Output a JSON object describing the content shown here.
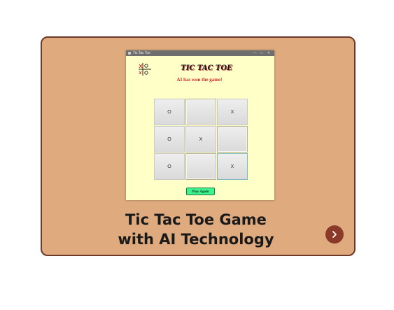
{
  "window": {
    "title": "Tic Tac Toe",
    "controls": [
      "—",
      "□",
      "✕"
    ]
  },
  "game": {
    "title": "TIC TAC TOE",
    "status": "AI has won the game!",
    "board": [
      "O",
      "",
      "X",
      "O",
      "X",
      "",
      "O",
      "",
      "X"
    ],
    "play_again_label": "Play Again"
  },
  "caption": {
    "line1": "Tic Tac Toe Game",
    "line2": "with AI Technology"
  },
  "icons": {
    "next": "chevron-right-icon",
    "logo": "tic-tac-toe-logo-icon"
  },
  "colors": {
    "card": "#deaa7e",
    "card_border": "#6b3a2a",
    "window_bg": "#ffffc8",
    "status": "#d42a2a",
    "play_again": "#3ef28c",
    "next_button": "#8b3a2a"
  }
}
